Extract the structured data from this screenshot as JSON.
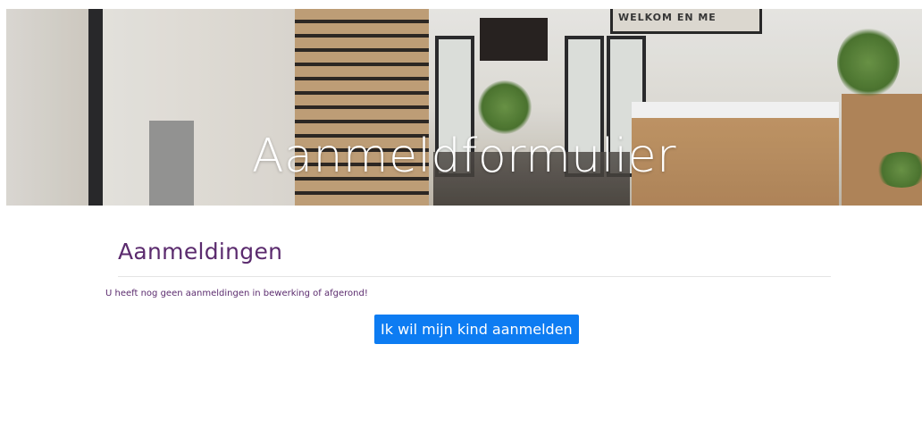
{
  "hero": {
    "title": "Aanmeldformulier",
    "sign_text": "WELKOM EN ME"
  },
  "applications": {
    "heading": "Aanmeldingen",
    "empty_message": "U heeft nog geen aanmeldingen in bewerking of afgerond!",
    "register_button_label": "Ik wil mijn kind aanmelden"
  },
  "colors": {
    "heading": "#5b2b6e",
    "button": "#0d7cf2",
    "divider": "#e4e4e4"
  }
}
